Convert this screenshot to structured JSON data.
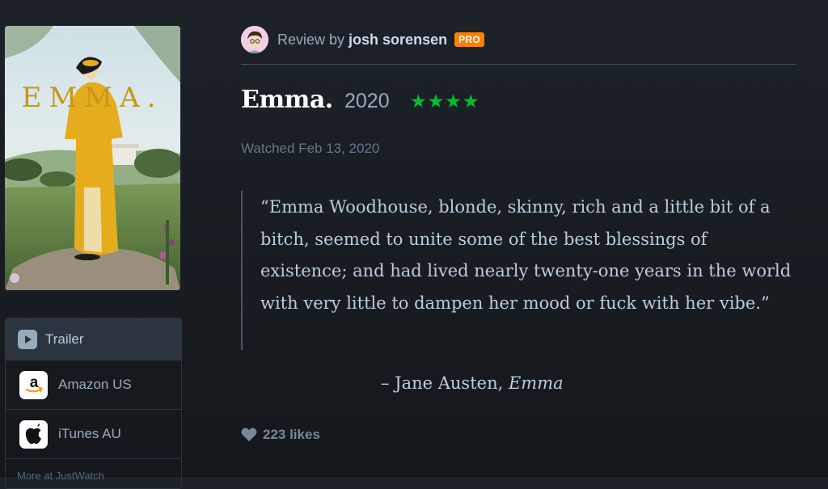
{
  "poster": {
    "title_text": "EMMA."
  },
  "services": {
    "trailer_label": "Trailer",
    "items": [
      {
        "label": "Amazon US",
        "icon": "amazon-icon"
      },
      {
        "label": "iTunes AU",
        "icon": "apple-icon"
      }
    ],
    "more_label": "More at JustWatch"
  },
  "review": {
    "by_prefix": "Review by",
    "username": "josh sorensen",
    "badge": "PRO",
    "film_title": "Emma.",
    "year": "2020",
    "rating": 4,
    "rating_stars": "★★★★",
    "watched": "Watched Feb 13, 2020",
    "quote": "“Emma Woodhouse, blonde, skinny, rich and a little bit of a bitch, seemed to unite some of the best blessings of existence; and had lived nearly twenty-one years in the world with very little to dampen her mood or fuck with her vibe.”",
    "attribution_prefix": "– Jane Austen,",
    "attribution_work": "Emma",
    "likes": "223 likes"
  },
  "colors": {
    "background": "#14181c",
    "star_green": "#00c030",
    "pro_orange": "#ff8000"
  }
}
